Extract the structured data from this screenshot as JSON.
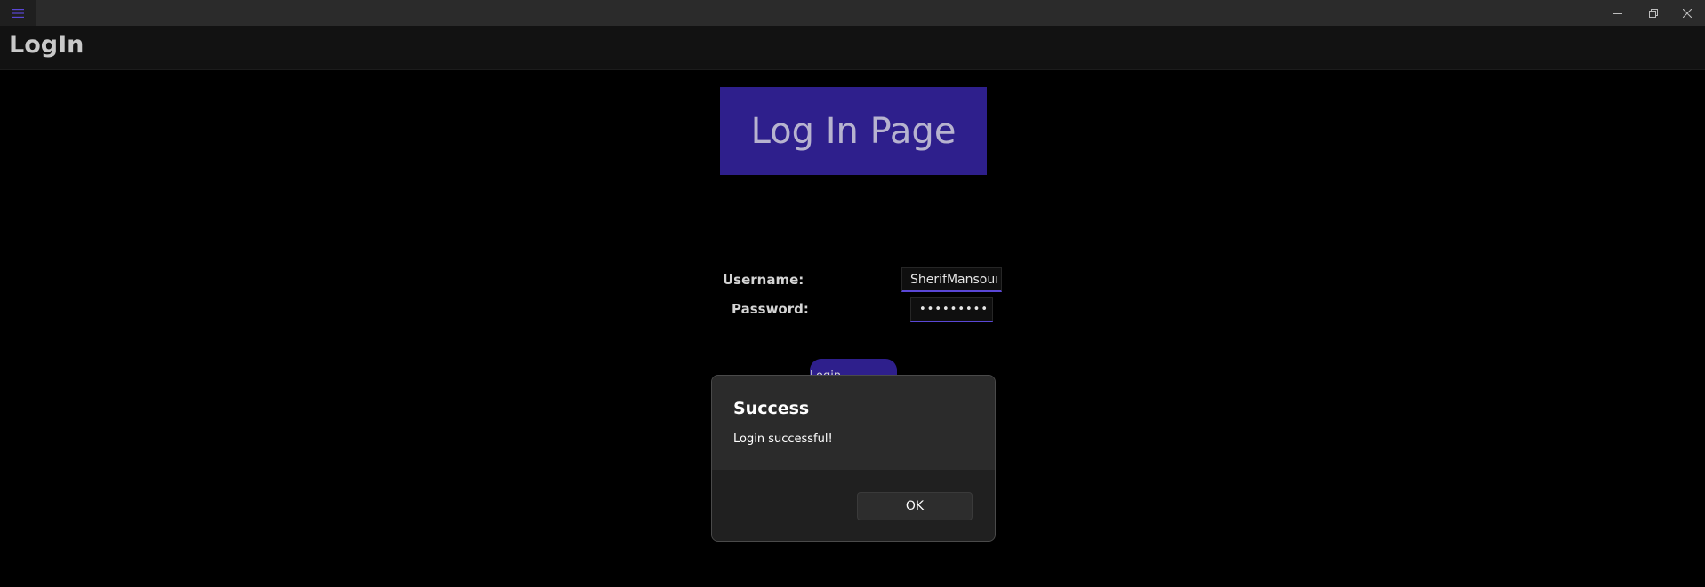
{
  "window": {
    "menu_icon": "hamburger-icon",
    "controls": [
      "minimize-icon",
      "restore-icon",
      "close-icon"
    ]
  },
  "header": {
    "title": "LogIn"
  },
  "banner": {
    "text": "Log In Page",
    "color": "#2e1f8c"
  },
  "form": {
    "username_label": "Username:",
    "username_value": "SherifMansour",
    "password_label": "Password:",
    "password_value": "•••••••••",
    "login_button_label": "Login"
  },
  "dialog": {
    "title": "Success",
    "message": "Login successful!",
    "ok_label": "OK"
  },
  "colors": {
    "accent": "#2e1f8c",
    "field_underline": "#5a47d6",
    "background": "#000000"
  }
}
